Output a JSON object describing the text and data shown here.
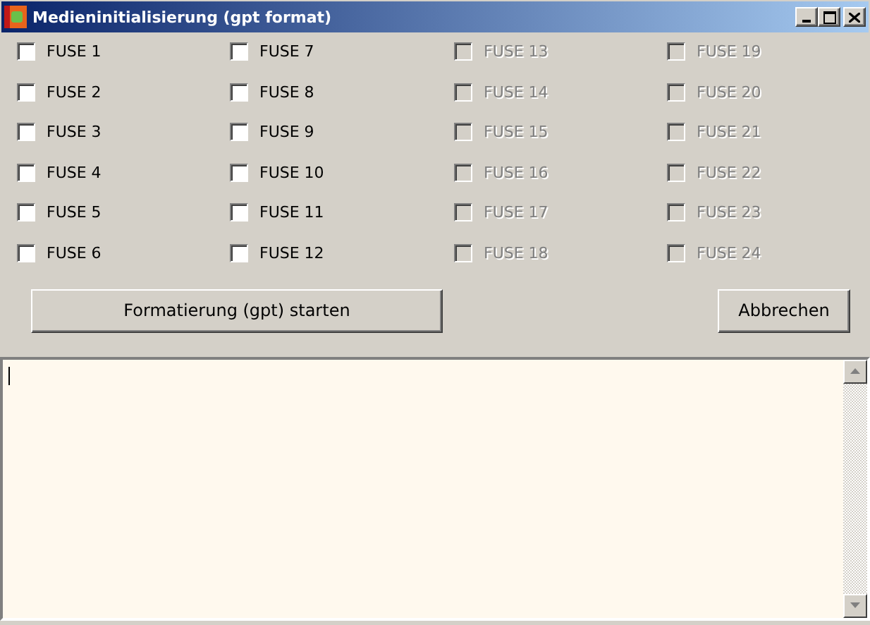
{
  "window": {
    "title": "Medieninitialisierung (gpt format)"
  },
  "columns": [
    [
      {
        "label": "FUSE 1",
        "checked": false,
        "disabled": false
      },
      {
        "label": "FUSE 2",
        "checked": false,
        "disabled": false
      },
      {
        "label": "FUSE 3",
        "checked": false,
        "disabled": false
      },
      {
        "label": "FUSE 4",
        "checked": false,
        "disabled": false
      },
      {
        "label": "FUSE 5",
        "checked": false,
        "disabled": false
      },
      {
        "label": "FUSE 6",
        "checked": false,
        "disabled": false
      }
    ],
    [
      {
        "label": "FUSE 7",
        "checked": false,
        "disabled": false
      },
      {
        "label": "FUSE 8",
        "checked": false,
        "disabled": false
      },
      {
        "label": "FUSE 9",
        "checked": false,
        "disabled": false
      },
      {
        "label": "FUSE 10",
        "checked": false,
        "disabled": false
      },
      {
        "label": "FUSE 11",
        "checked": false,
        "disabled": false
      },
      {
        "label": "FUSE 12",
        "checked": false,
        "disabled": false
      }
    ],
    [
      {
        "label": "FUSE 13",
        "checked": false,
        "disabled": true
      },
      {
        "label": "FUSE 14",
        "checked": false,
        "disabled": true
      },
      {
        "label": "FUSE 15",
        "checked": false,
        "disabled": true
      },
      {
        "label": "FUSE 16",
        "checked": false,
        "disabled": true
      },
      {
        "label": "FUSE 17",
        "checked": false,
        "disabled": true
      },
      {
        "label": "FUSE 18",
        "checked": false,
        "disabled": true
      }
    ],
    [
      {
        "label": "FUSE 19",
        "checked": false,
        "disabled": true
      },
      {
        "label": "FUSE 20",
        "checked": false,
        "disabled": true
      },
      {
        "label": "FUSE 21",
        "checked": false,
        "disabled": true
      },
      {
        "label": "FUSE 22",
        "checked": false,
        "disabled": true
      },
      {
        "label": "FUSE 23",
        "checked": false,
        "disabled": true
      },
      {
        "label": "FUSE 24",
        "checked": false,
        "disabled": true
      }
    ]
  ],
  "buttons": [
    {
      "label": "Formatierung (gpt) starten",
      "kind": "primary"
    },
    {
      "label": "Abbrechen",
      "kind": "cancel"
    }
  ]
}
